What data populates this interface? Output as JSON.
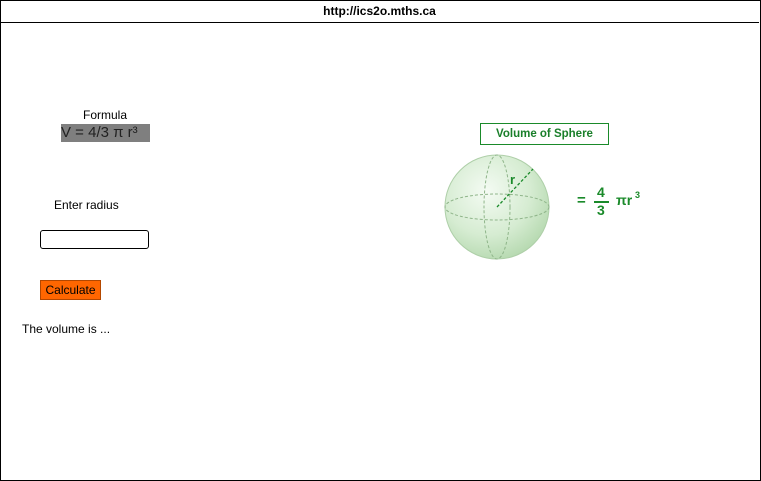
{
  "url_bar": {
    "url": "http://ics2o.mths.ca"
  },
  "formula": {
    "label": "Formula",
    "value": "V = 4/3 π r³"
  },
  "radius": {
    "label": "Enter radius",
    "value": "",
    "placeholder": ""
  },
  "calculate_button": {
    "label": "Calculate"
  },
  "result": {
    "text": "The volume is ..."
  },
  "diagram": {
    "title": "Volume of Sphere",
    "radius_label": "r",
    "equation": {
      "equals": "=",
      "numerator": "4",
      "denominator": "3",
      "rest": "πr",
      "exponent": "3"
    }
  },
  "colors": {
    "button_bg": "#ff6600",
    "formula_bg": "#7f7f7f",
    "diagram_green": "#1a8a2a"
  }
}
